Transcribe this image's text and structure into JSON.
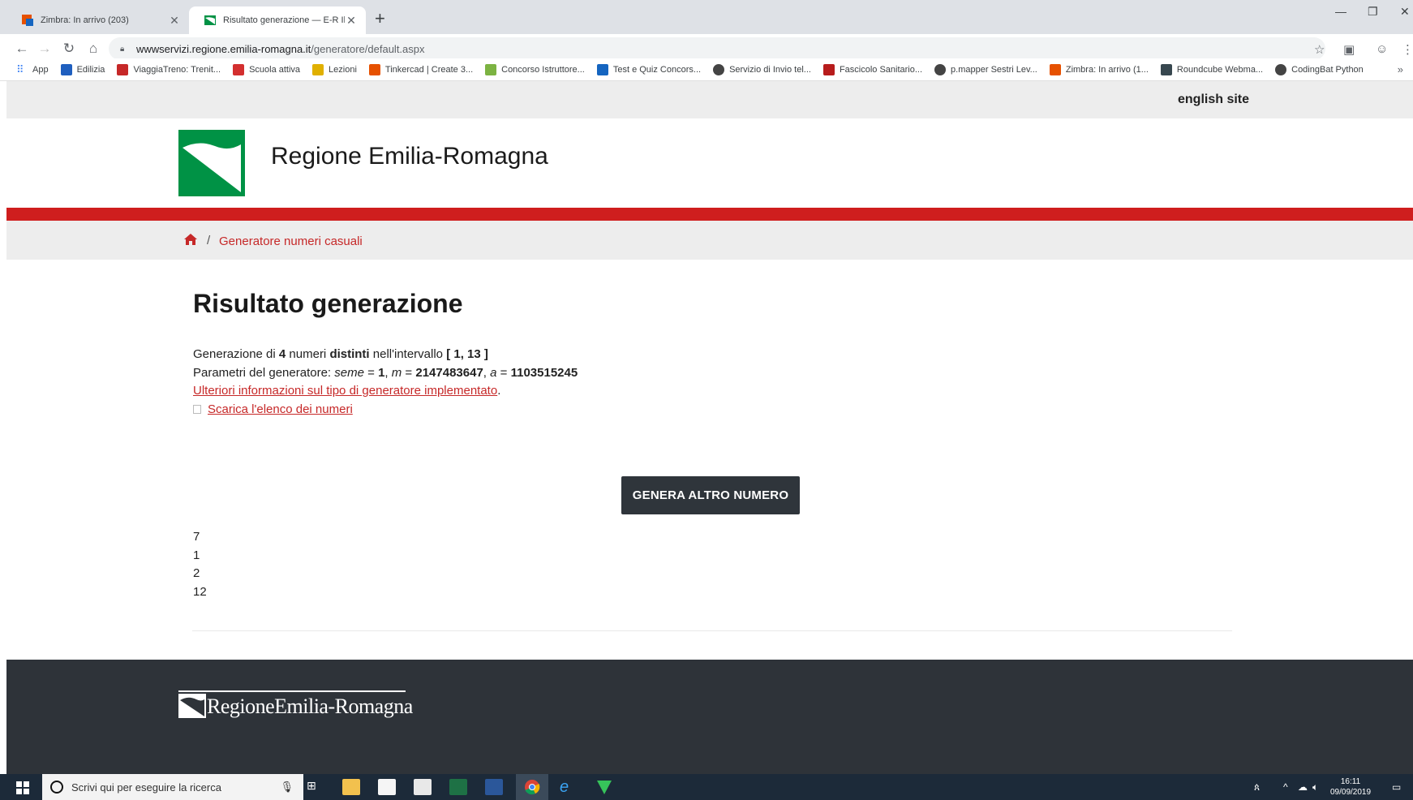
{
  "browser": {
    "tabs": [
      {
        "title": "Zimbra: In arrivo (203)"
      },
      {
        "title": "Risultato generazione — E-R Il pe"
      }
    ],
    "url_host": "wwwservizi.regione.emilia-romagna.it",
    "url_path": "/generatore/default.aspx",
    "bookmarks": [
      {
        "label": "App",
        "color": "#4285f4"
      },
      {
        "label": "Edilizia",
        "color": "#1f5fbf"
      },
      {
        "label": "ViaggiaTreno: Trenit...",
        "color": "#c62828"
      },
      {
        "label": "Scuola attiva",
        "color": "#d32f2f"
      },
      {
        "label": "Lezioni",
        "color": "#e0b000"
      },
      {
        "label": "Tinkercad | Create 3...",
        "color": "#e65100"
      },
      {
        "label": "Concorso Istruttore...",
        "color": "#7cb342"
      },
      {
        "label": "Test e Quiz Concors...",
        "color": "#1565c0"
      },
      {
        "label": "Servizio di Invio tel...",
        "color": "#444444"
      },
      {
        "label": "Fascicolo Sanitario...",
        "color": "#b71c1c"
      },
      {
        "label": "p.mapper Sestri Lev...",
        "color": "#444444"
      },
      {
        "label": "Zimbra: In arrivo (1...",
        "color": "#e65100"
      },
      {
        "label": "Roundcube Webma...",
        "color": "#37474f"
      },
      {
        "label": "CodingBat Python",
        "color": "#444444"
      }
    ],
    "more": "»"
  },
  "page": {
    "english_link": "english site",
    "site_title": "Regione Emilia-Romagna",
    "breadcrumb_sep": "/",
    "breadcrumb_link": "Generatore numeri casuali",
    "heading": "Risultato generazione",
    "line1": {
      "pre": "Generazione di ",
      "count": "4",
      "mid1": " numeri ",
      "distinct": "distinti",
      "mid2": " nell'intervallo ",
      "range": "[ 1, 13 ]"
    },
    "line2": {
      "pre": "Parametri del generatore: ",
      "seed_label": "seme",
      "seed_eq": " = ",
      "seed_val": "1",
      "sep1": ", ",
      "m_label": "m",
      "m_eq": " = ",
      "m_val": "2147483647",
      "sep2": ", ",
      "a_label": "a",
      "a_eq": " = ",
      "a_val": "1103515245"
    },
    "more_info_link": "Ulteriori informazioni sul tipo di generatore implementato",
    "more_info_suffix": ".",
    "download_link": "Scarica l'elenco dei numeri",
    "generate_button": "GENERA ALTRO NUMERO",
    "numbers": [
      "7",
      "1",
      "2",
      "12"
    ],
    "footer_logo_text": "RegioneEmilia-Romagna",
    "brand_green": "#009245",
    "brand_red": "#cf1e1e"
  },
  "taskbar": {
    "search_placeholder": "Scrivi qui per eseguire la ricerca",
    "time": "16:11",
    "date": "09/09/2019"
  }
}
